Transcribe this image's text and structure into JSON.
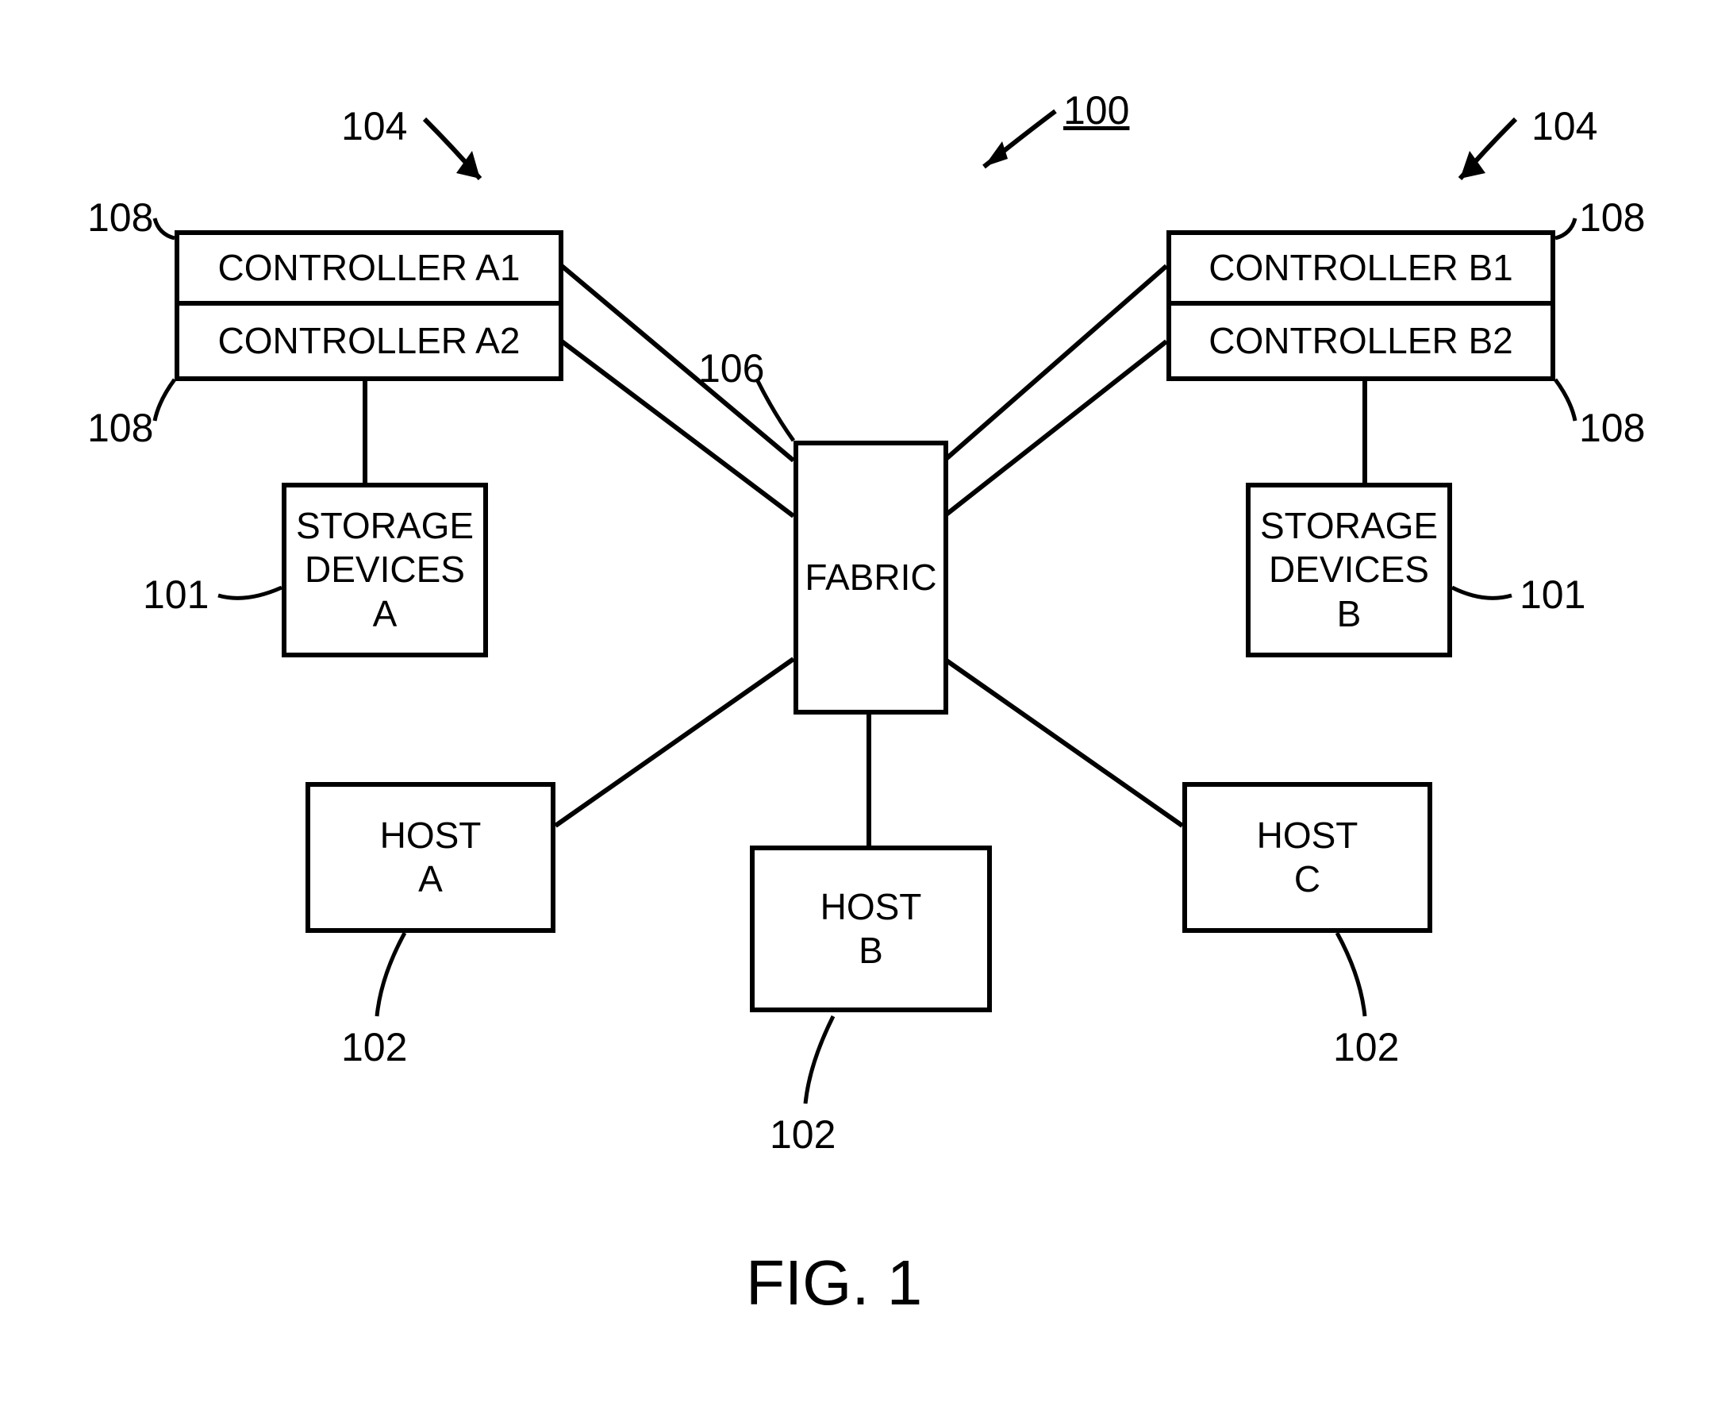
{
  "figure_caption": "FIG. 1",
  "labels": {
    "ref100": "100",
    "ref104_left": "104",
    "ref104_right": "104",
    "ref106": "106",
    "ref108_tl": "108",
    "ref108_bl": "108",
    "ref108_tr": "108",
    "ref108_br": "108",
    "ref101_left": "101",
    "ref101_right": "101",
    "ref102_left": "102",
    "ref102_mid": "102",
    "ref102_right": "102"
  },
  "boxes": {
    "controller_a1": "CONTROLLER A1",
    "controller_a2": "CONTROLLER A2",
    "controller_b1": "CONTROLLER B1",
    "controller_b2": "CONTROLLER B2",
    "storage_a": "STORAGE\nDEVICES\nA",
    "storage_b": "STORAGE\nDEVICES\nB",
    "fabric": "FABRIC",
    "host_a": "HOST\nA",
    "host_b": "HOST\nB",
    "host_c": "HOST\nC"
  }
}
